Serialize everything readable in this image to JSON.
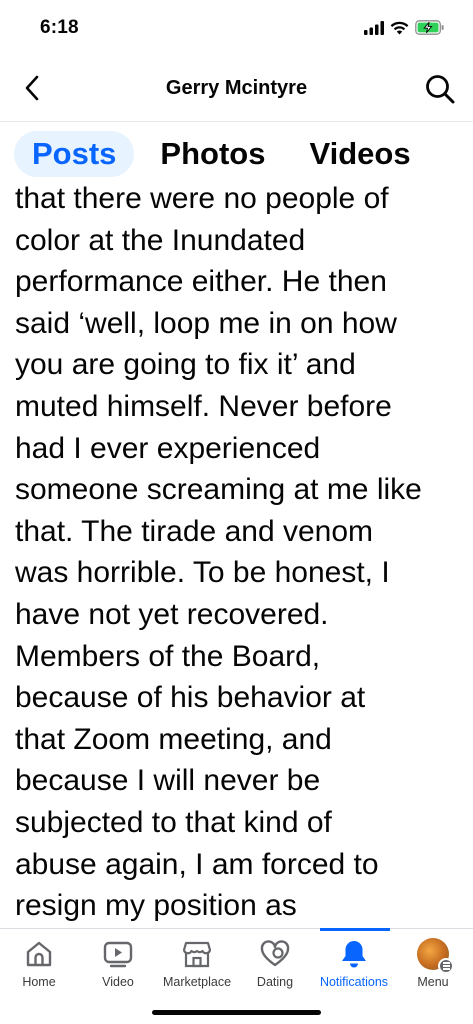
{
  "status_bar": {
    "time": "6:18",
    "icons": [
      "signal-icon",
      "wifi-icon",
      "battery-charging-icon"
    ],
    "battery_color": "#30d158"
  },
  "header": {
    "title": "Gerry Mcintyre",
    "back_icon": "chevron-left-icon",
    "search_icon": "search-icon"
  },
  "tabs": [
    {
      "label": "Posts",
      "active": true
    },
    {
      "label": "Photos",
      "active": false
    },
    {
      "label": "Videos",
      "active": false
    }
  ],
  "post": {
    "lines": [
      "that there were no people of",
      "color at the Inundated",
      "performance either. He then",
      "said ‘well, loop me in on how",
      "you are going to fix it’ and",
      "muted himself. Never before",
      "had I ever experienced",
      "someone screaming at me like",
      "that. The tirade and venom",
      "was horrible. To be honest, I",
      "have not yet recovered.",
      "Members of the Board,",
      "because of his behavior at",
      "that Zoom meeting, and",
      "because I will never be",
      "subjected to that kind of",
      "abuse again, I am forced to",
      "resign my position as"
    ]
  },
  "bottom_nav": {
    "items": [
      {
        "label": "Home",
        "icon": "home-icon"
      },
      {
        "label": "Video",
        "icon": "video-icon"
      },
      {
        "label": "Marketplace",
        "icon": "marketplace-icon"
      },
      {
        "label": "Dating",
        "icon": "dating-icon"
      },
      {
        "label": "Notifications",
        "icon": "bell-icon",
        "active": true
      },
      {
        "label": "Menu",
        "icon": "avatar"
      }
    ]
  },
  "colors": {
    "accent": "#0866ff",
    "active_tab_bg": "#e7f3ff",
    "text": "#050505"
  }
}
